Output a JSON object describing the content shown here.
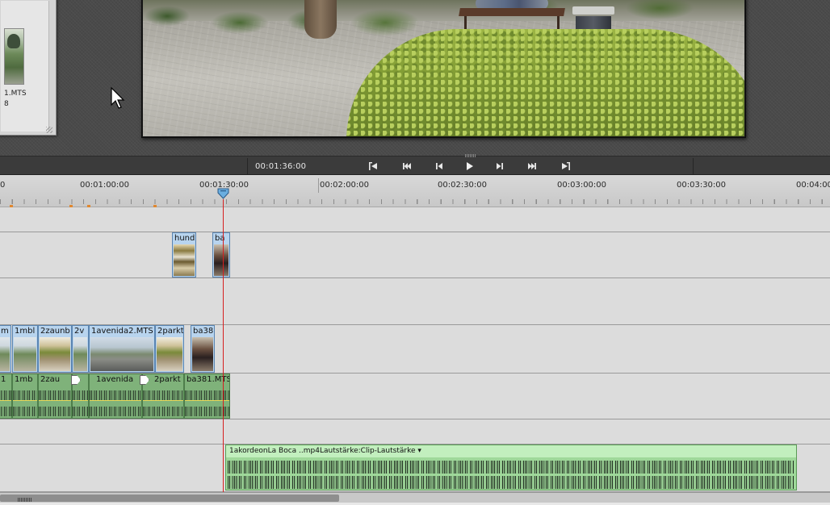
{
  "media_panel": {
    "clip_name": "1.MTS",
    "clip_duration": "8"
  },
  "monitor": {
    "timecode": "00:01:36:00",
    "controls": [
      {
        "name": "go-to-in-point-button",
        "icon": "go-to-in-icon"
      },
      {
        "name": "go-to-start-button",
        "icon": "skip-back-icon"
      },
      {
        "name": "step-back-button",
        "icon": "step-back-icon"
      },
      {
        "name": "play-button",
        "icon": "play-icon"
      },
      {
        "name": "step-forward-button",
        "icon": "step-forward-icon"
      },
      {
        "name": "go-to-end-button",
        "icon": "skip-forward-icon"
      },
      {
        "name": "go-to-out-point-button",
        "icon": "go-to-out-icon"
      }
    ]
  },
  "ruler": {
    "labels": [
      "0",
      "00:01:00:00",
      "00:01:30:00",
      "00:02:00:00",
      "00:02:30:00",
      "00:03:00:00",
      "00:03:30:00",
      "00:04:00"
    ]
  },
  "tracks": {
    "overlay_clips": [
      "hund",
      "ba"
    ],
    "video_clips": [
      "m",
      "1mbl",
      "2zaunb",
      "2v",
      "1avenida2.MTS [",
      "2parkt",
      "ba38"
    ],
    "audio_clips": [
      "1",
      "1mb",
      "2zau",
      "1avenida",
      "2parkt",
      "ba381.MTS"
    ],
    "music_clip": {
      "name": "1akordeonLa Boca ..mp4",
      "volume_label": "Lautstärke:Clip-Lautstärke ▾"
    }
  },
  "colors": {
    "video_clip": "#b8d4ee",
    "audio_clip": "#7fb27a",
    "music_clip": "#9fd89a",
    "playhead": "#d62020"
  }
}
